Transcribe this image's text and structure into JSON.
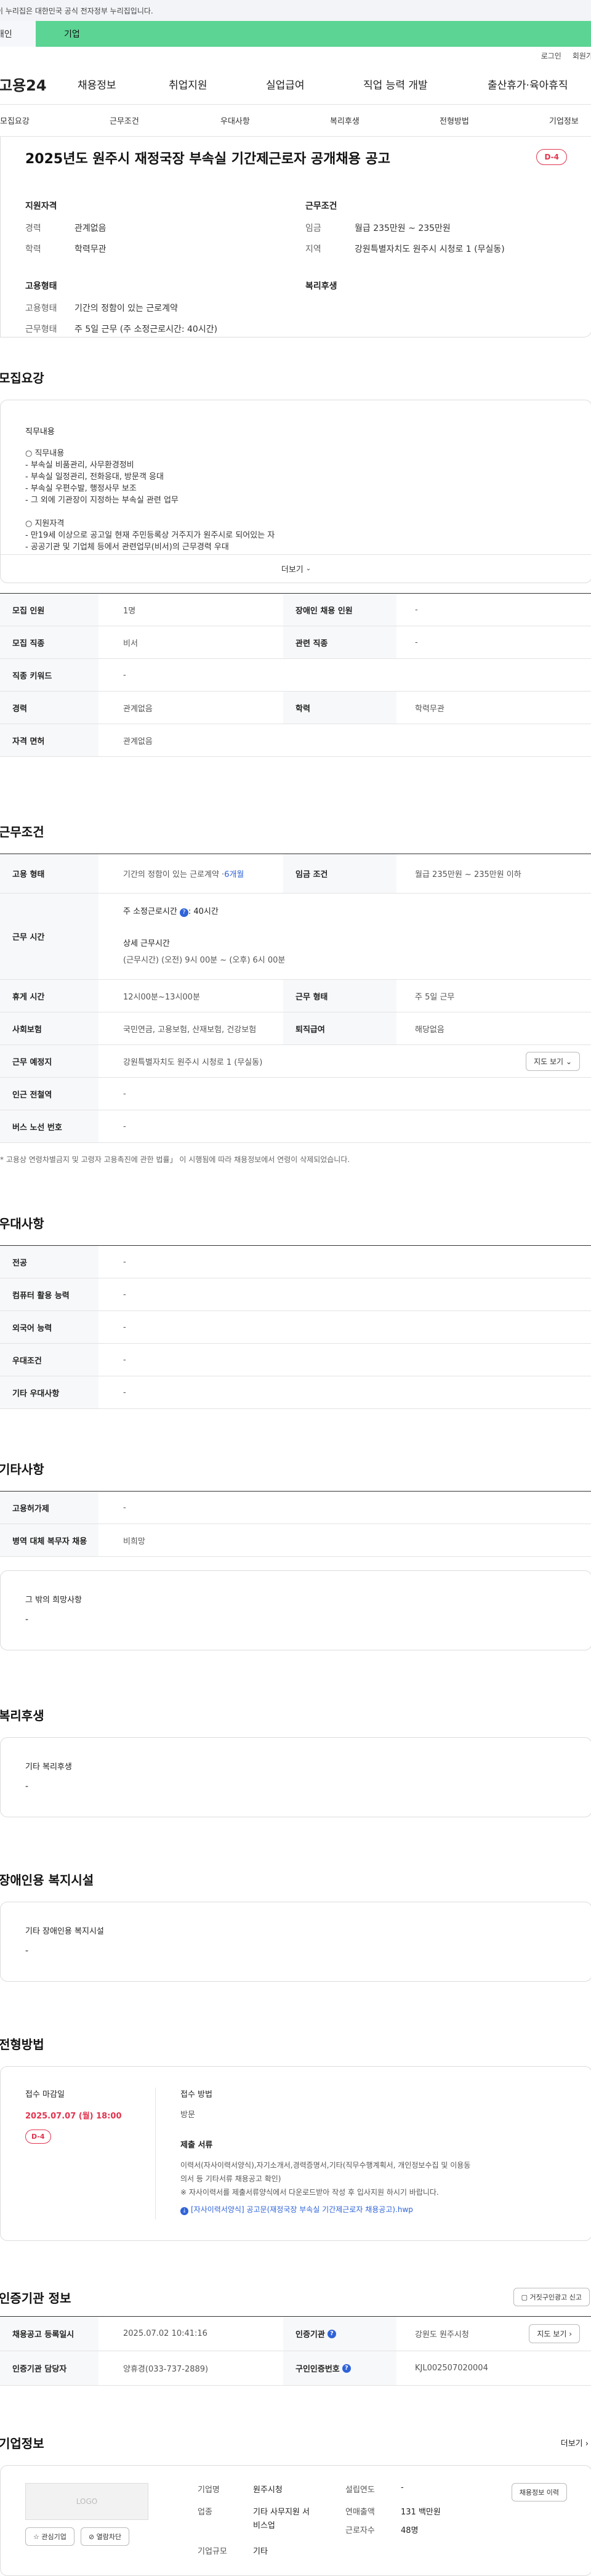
{
  "gov_banner": "이 누리집은 대한민국 공식 전자정부 누리집입니다.",
  "portal_tabs": [
    "개인",
    "기업"
  ],
  "util": [
    "로그인",
    "회원가입"
  ],
  "logo": "고용24",
  "gnb": [
    "채용정보",
    "취업지원",
    "실업급여",
    "직업 능력 개발",
    "출산휴가·육아휴직"
  ],
  "anchors": [
    "모집요강",
    "근무조건",
    "우대사항",
    "복리후생",
    "전형방법",
    "기업정보"
  ],
  "summary": {
    "title": "2025년도 원주시 재정국장 부속실 기간제근로자 공개채용 공고",
    "dday": "D-4",
    "qual_head": "지원자격",
    "career_k": "경력",
    "career_v": "관계없음",
    "edu_k": "학력",
    "edu_v": "학력무관",
    "cond_head": "근무조건",
    "wage_k": "임금",
    "wage_v": "월급 235만원 ~ 235만원",
    "loc_k": "지역",
    "loc_v": "강원특별자치도 원주시 시청로 1 (무실동)",
    "emp_head": "고용형태",
    "etype_k": "고용형태",
    "etype_v": "기간의 정함이 있는 근로계약",
    "ework_k": "근무형태",
    "ework_v": "주 5일 근무 (주 소정근로시간: 40시간)",
    "welfare_head": "복리후생"
  },
  "recruit": {
    "title": "모집요강",
    "job_head": "직무내용",
    "lines": [
      "○ 직무내용",
      "- 부속실 비품관리, 사무환경정비",
      "- 부속실 일정관리, 전화응대, 방문객 응대",
      "- 부속실 우편수발, 행정사무 보조",
      "- 그 외에 기관장이 지정하는 부속실 관련 업무",
      "",
      "○ 지원자격",
      "- 만19세 이상으로 공고일 현재 주민등록상 거주지가 원주시로 되어있는 자",
      "- 공공기관 및 기업체 등에서 관련업무(비서)의 근무경력 우대"
    ],
    "more": "더보기"
  },
  "recruit_table": {
    "r1": [
      "모집 인원",
      "1명",
      "장애인 채용 인원",
      "-"
    ],
    "r2": [
      "모집 직종",
      "비서",
      "관련 직종",
      "-"
    ],
    "r3": [
      "직종 키워드",
      "-"
    ],
    "r4": [
      "경력",
      "관계없음",
      "학력",
      "학력무관"
    ],
    "r5": [
      "자격 면허",
      "관계없음"
    ]
  },
  "work": {
    "title": "근무조건",
    "etype_k": "고용 형태",
    "etype_v": "기간의 정함이 있는 근로계약 · ",
    "etype_m": "6개월",
    "wage_k": "임금 조건",
    "wage_v": "월급 235만원 ~ 235만원 이하",
    "hours_k": "근무 시간",
    "hours_a": "주 소정근로시간",
    "hours_b": ": 40시간",
    "hours_c": "상세 근무시간",
    "hours_d": "(근무시간) (오전) 9시 00분 ~ (오후) 6시 00분",
    "rest_k": "휴게 시간",
    "rest_v": "12시00분~13시00분",
    "wf_k": "근무 형태",
    "wf_v": "주 5일 근무",
    "ins_k": "사회보험",
    "ins_v": "국민연금, 고용보험, 산재보험, 건강보험",
    "sev_k": "퇴직급여",
    "sev_v": "해당없음",
    "place_k": "근무 예정지",
    "place_v": "강원특별자치도 원주시 시청로 1 (무실동)",
    "map": "지도 보기",
    "sub_k": "인근 전철역",
    "sub_v": "-",
    "bus_k": "버스 노선 번호",
    "bus_v": "-",
    "note": "* 고용상 연령차별금지 및 고령자 고용촉진에 관한 법률」 이 시행됨에 따라 채용정보에서 연령이 삭제되었습니다."
  },
  "pref": {
    "title": "우대사항",
    "rows": [
      [
        "전공",
        "-"
      ],
      [
        "컴퓨터 활용 능력",
        "-"
      ],
      [
        "외국어 능력",
        "-"
      ],
      [
        "우대조건",
        "-"
      ],
      [
        "기타 우대사항",
        "-"
      ]
    ]
  },
  "etc": {
    "title": "기타사항",
    "rows": [
      [
        "고용허가제",
        "-"
      ],
      [
        "병역 대체 복무자 채용",
        "비희망"
      ]
    ],
    "card_head": "그 밖의 희망사항",
    "card_v": "-"
  },
  "welfare": {
    "title": "복리후생",
    "head": "기타 복리후생",
    "v": "-"
  },
  "disabled": {
    "title": "장애인용 복지시설",
    "head": "기타 장애인용 복지시설",
    "v": "-"
  },
  "process": {
    "title": "전형방법",
    "deadline_k": "접수 마감일",
    "deadline_v": "2025.07.07 (월) 18:00",
    "dday": "D-4",
    "method_k": "접수 방법",
    "method_v": "방문",
    "docs_k": "제출 서류",
    "docs_v1": "이력서(자사이력서양식),자기소개서,경력증명서,기타(직무수행계획서, 개인정보수집 및 이용동",
    "docs_v2": "의서 등 기타서류 채용공고 확인)",
    "docs_v3": "※ 자사이력서를 제출서류양식에서 다운로드받아 작성 후 입사지원 하시기 바랍니다.",
    "file": "[자사이력서양식] 공고문(재정국장 부속실 기간제근로자 채용공고).hwp"
  },
  "agency": {
    "title": "인증기관 정보",
    "report": "거짓구인광고 신고",
    "r1": [
      "채용공고 등록일시",
      "2025.07.02 10:41:16",
      "인증기관",
      "강원도 원주시청"
    ],
    "map": "지도 보기",
    "r2": [
      "인증기관 담당자",
      "양휴경(033-737-2889)",
      "구인인증번호",
      "KJL002507020004"
    ]
  },
  "company": {
    "title": "기업정보",
    "more": "더보기",
    "logo": "LOGO",
    "fav": "관심기업",
    "block": "열람차단",
    "name_k": "기업명",
    "name_v": "원주시청",
    "year_k": "설립연도",
    "year_v": "-",
    "hist": "채용정보 이력",
    "ind_k": "업종",
    "ind_v1": "기타 사무지원 서",
    "ind_v2": "비스업",
    "sales_k": "연매출액",
    "sales_v": "131 백만원",
    "emp_k": "근로자수",
    "emp_v": "48명",
    "size_k": "기업규모",
    "size_v": "기타"
  }
}
